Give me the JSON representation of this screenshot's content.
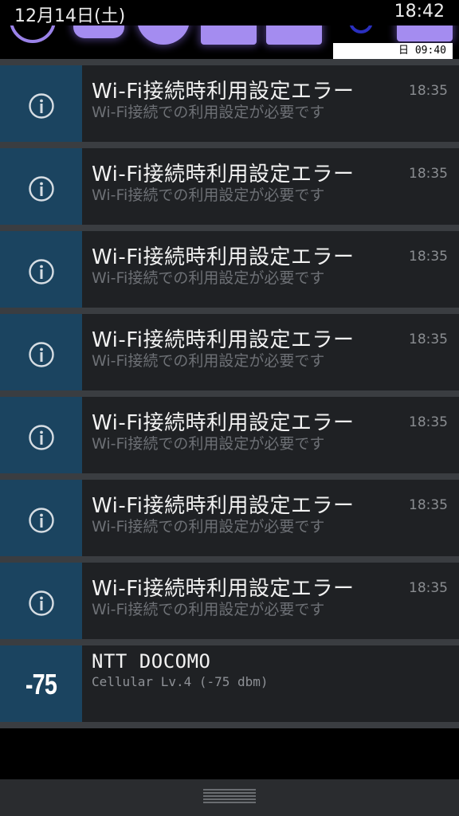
{
  "status_bar": {
    "date": "12月14日(土)",
    "time": "18:42"
  },
  "quick_settings": {
    "alarm_label": "日 09:40",
    "accent_color": "#a48cf0"
  },
  "notifications": [
    {
      "title": "Wi-Fi接続時利用設定エラー",
      "subtitle": "Wi-Fi接続での利用設定が必要です",
      "time": "18:35",
      "icon": "info-icon"
    },
    {
      "title": "Wi-Fi接続時利用設定エラー",
      "subtitle": "Wi-Fi接続での利用設定が必要です",
      "time": "18:35",
      "icon": "info-icon"
    },
    {
      "title": "Wi-Fi接続時利用設定エラー",
      "subtitle": "Wi-Fi接続での利用設定が必要です",
      "time": "18:35",
      "icon": "info-icon"
    },
    {
      "title": "Wi-Fi接続時利用設定エラー",
      "subtitle": "Wi-Fi接続での利用設定が必要です",
      "time": "18:35",
      "icon": "info-icon"
    },
    {
      "title": "Wi-Fi接続時利用設定エラー",
      "subtitle": "Wi-Fi接続での利用設定が必要です",
      "time": "18:35",
      "icon": "info-icon"
    },
    {
      "title": "Wi-Fi接続時利用設定エラー",
      "subtitle": "Wi-Fi接続での利用設定が必要です",
      "time": "18:35",
      "icon": "info-icon"
    },
    {
      "title": "Wi-Fi接続時利用設定エラー",
      "subtitle": "Wi-Fi接続での利用設定が必要です",
      "time": "18:35",
      "icon": "info-icon"
    }
  ],
  "cellular": {
    "badge": "-75",
    "title": "NTT DOCOMO",
    "subtitle": "Cellular Lv.4 (-75 dbm)"
  },
  "colors": {
    "icon_column": "#1b4460",
    "card_bg": "#1f2124",
    "separator": "#3a3d41"
  }
}
